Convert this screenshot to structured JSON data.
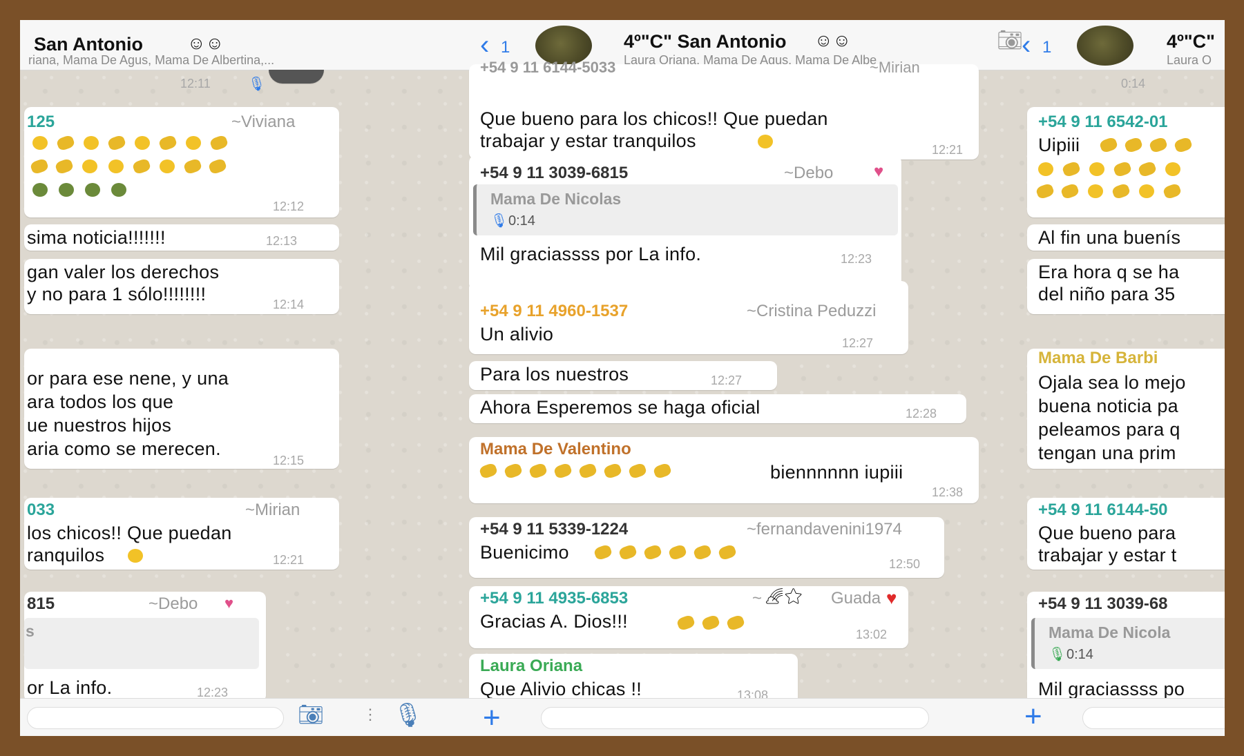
{
  "left_panel": {
    "title": "San Antonio",
    "subtitle": "riana, Mama De Agus, Mama De Albertina,...",
    "top_time": "12:11",
    "messages": [
      {
        "sender": "125",
        "name": "~Viviana",
        "time": "12:12"
      },
      {
        "text": "sima noticia!!!!!!!",
        "time": "12:13"
      },
      {
        "line1": "gan valer los derechos",
        "line2": " y no para 1 sólo!!!!!!!!",
        "time": "12:14"
      },
      {
        "line1": "or para ese nene, y una",
        "line2": "ara todos los que",
        "line3": "ue nuestros hijos",
        "line4": "aria como se merecen.",
        "time": "12:15"
      },
      {
        "sender": "033",
        "name": "~Mirian",
        "line1": " los chicos!! Que puedan",
        "line2": "ranquilos",
        "time": "12:21"
      },
      {
        "sender": "815",
        "name": "~Debo",
        "quote_name": "s",
        "text": "or La info.",
        "time": "12:23"
      }
    ]
  },
  "center_panel": {
    "back_count": "1",
    "title": "4º\"C\" San Antonio",
    "subtitle": "Laura Oriana, Mama De Agus, Mama De Albe",
    "messages": [
      {
        "sender": "+54 9 11 6144-5033",
        "name": "~Mirian",
        "line1": "Que bueno para los chicos!! Que puedan",
        "line2": "trabajar y estar tranquilos",
        "time": "12:21"
      },
      {
        "sender": "+54 9 11 3039-6815",
        "name": "~Debo",
        "quote_name": "Mama De Nicolas",
        "quote_duration": "0:14",
        "text": "Mil graciassss por La info.",
        "time": "12:23"
      },
      {
        "sender": "+54 9 11 4960-1537",
        "name": "~Cristina Peduzzi",
        "text": "Un alivio",
        "time": "12:27"
      },
      {
        "text": "Para los nuestros",
        "time": "12:27"
      },
      {
        "text": "Ahora Esperemos se haga oficial",
        "time": "12:28"
      },
      {
        "sender": "Mama De Valentino",
        "text": "biennnnnn iupiii",
        "time": "12:38"
      },
      {
        "sender": "+54 9 11 5339-1224",
        "name": "~fernandavenini1974",
        "text": "Buenicimo",
        "time": "12:50"
      },
      {
        "sender": "+54 9 11 4935-6853",
        "name": "~",
        "name2": "Guada",
        "text": "Gracias A. Dios!!!",
        "time": "13:02"
      },
      {
        "sender": "Laura Oriana",
        "text": "Que Alivio chicas !!",
        "time": "13:08"
      }
    ]
  },
  "right_panel": {
    "back_count": "1",
    "title": "4º\"C\"",
    "subtitle": "Laura O",
    "top_time": "0:14",
    "messages": [
      {
        "sender": "+54 9 11 6542-01",
        "text": "Uipiii"
      },
      {
        "text": "Al fin una buenís"
      },
      {
        "line1": "Era hora q se ha",
        "line2": "del niño para 35"
      },
      {
        "sender": "Mama De Barbi",
        "line1": "Ojala sea lo mejo",
        "line2": "buena noticia pa",
        "line3": "peleamos para q",
        "line4": "tengan una prim"
      },
      {
        "sender": "+54 9 11 6144-50",
        "line1": "Que bueno para",
        "line2": "trabajar y estar t"
      },
      {
        "sender": "+54 9 11 3039-68",
        "quote_name": "Mama De Nicola",
        "quote_duration": "0:14",
        "text": "Mil graciassss po"
      }
    ]
  },
  "colors": {
    "accent": "#2f7be8",
    "frame": "#7a5028",
    "orange_sender": "#e8a22b",
    "teal_sender": "#2ba59a",
    "green_sender": "#3aaa55",
    "brown_sender": "#c0712a"
  }
}
